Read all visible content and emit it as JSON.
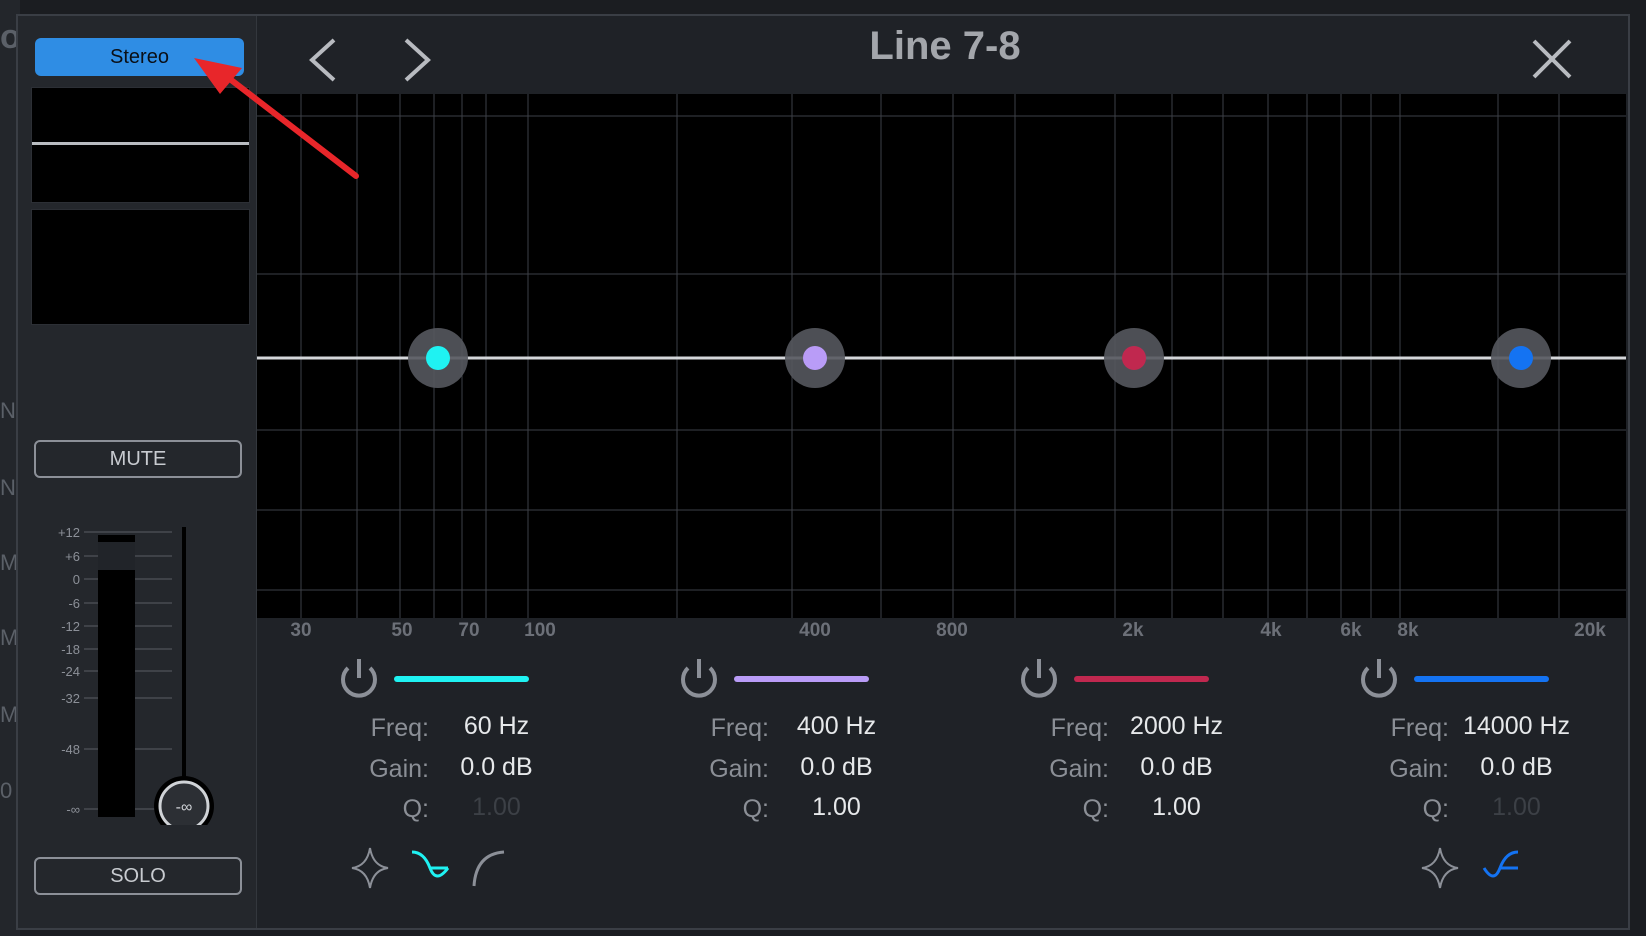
{
  "background_fragments": [
    "o",
    "N",
    "N",
    "M",
    "M",
    "M",
    "0"
  ],
  "window_title": "Line 7-8",
  "sidebar": {
    "stereo_label": "Stereo",
    "mute_label": "MUTE",
    "solo_label": "SOLO",
    "fader": {
      "scale_labels": [
        "+12",
        "+6",
        "0",
        "-6",
        "-12",
        "-18",
        "-24",
        "-32",
        "-48",
        "-∞"
      ],
      "knob_value": "-∞"
    }
  },
  "header": {
    "prev_icon": "chevron-left-icon",
    "next_icon": "chevron-right-icon",
    "close_icon": "close-icon"
  },
  "freq_axis": [
    "30",
    "50",
    "70",
    "100",
    "400",
    "800",
    "2k",
    "4k",
    "6k",
    "8k",
    "20k"
  ],
  "bands": [
    {
      "color": "#1ff2f2",
      "freq_label": "Freq:",
      "freq": "60 Hz",
      "gain_label": "Gain:",
      "gain": "0.0 dB",
      "q_label": "Q:",
      "q": "1.00",
      "q_active": false,
      "shapes": [
        "bell-shape-icon",
        "low-shelf-shape-icon",
        "high-pass-shape-icon"
      ],
      "selected_shape": "low-shelf-shape-icon"
    },
    {
      "color": "#b99cf7",
      "freq_label": "Freq:",
      "freq": "400 Hz",
      "gain_label": "Gain:",
      "gain": "0.0 dB",
      "q_label": "Q:",
      "q": "1.00",
      "q_active": true
    },
    {
      "color": "#c0284f",
      "freq_label": "Freq:",
      "freq": "2000 Hz",
      "gain_label": "Gain:",
      "gain": "0.0 dB",
      "q_label": "Q:",
      "q": "1.00",
      "q_active": true
    },
    {
      "color": "#1473f2",
      "freq_label": "Freq:",
      "freq": "14000 Hz",
      "gain_label": "Gain:",
      "gain": "0.0 dB",
      "q_label": "Q:",
      "q": "1.00",
      "q_active": false,
      "shapes": [
        "bell-shape-icon",
        "high-shelf-shape-icon"
      ],
      "selected_shape": "high-shelf-shape-icon"
    }
  ],
  "colors": {
    "accent": "#2f8de4",
    "annotation_arrow": "#e8262a"
  }
}
